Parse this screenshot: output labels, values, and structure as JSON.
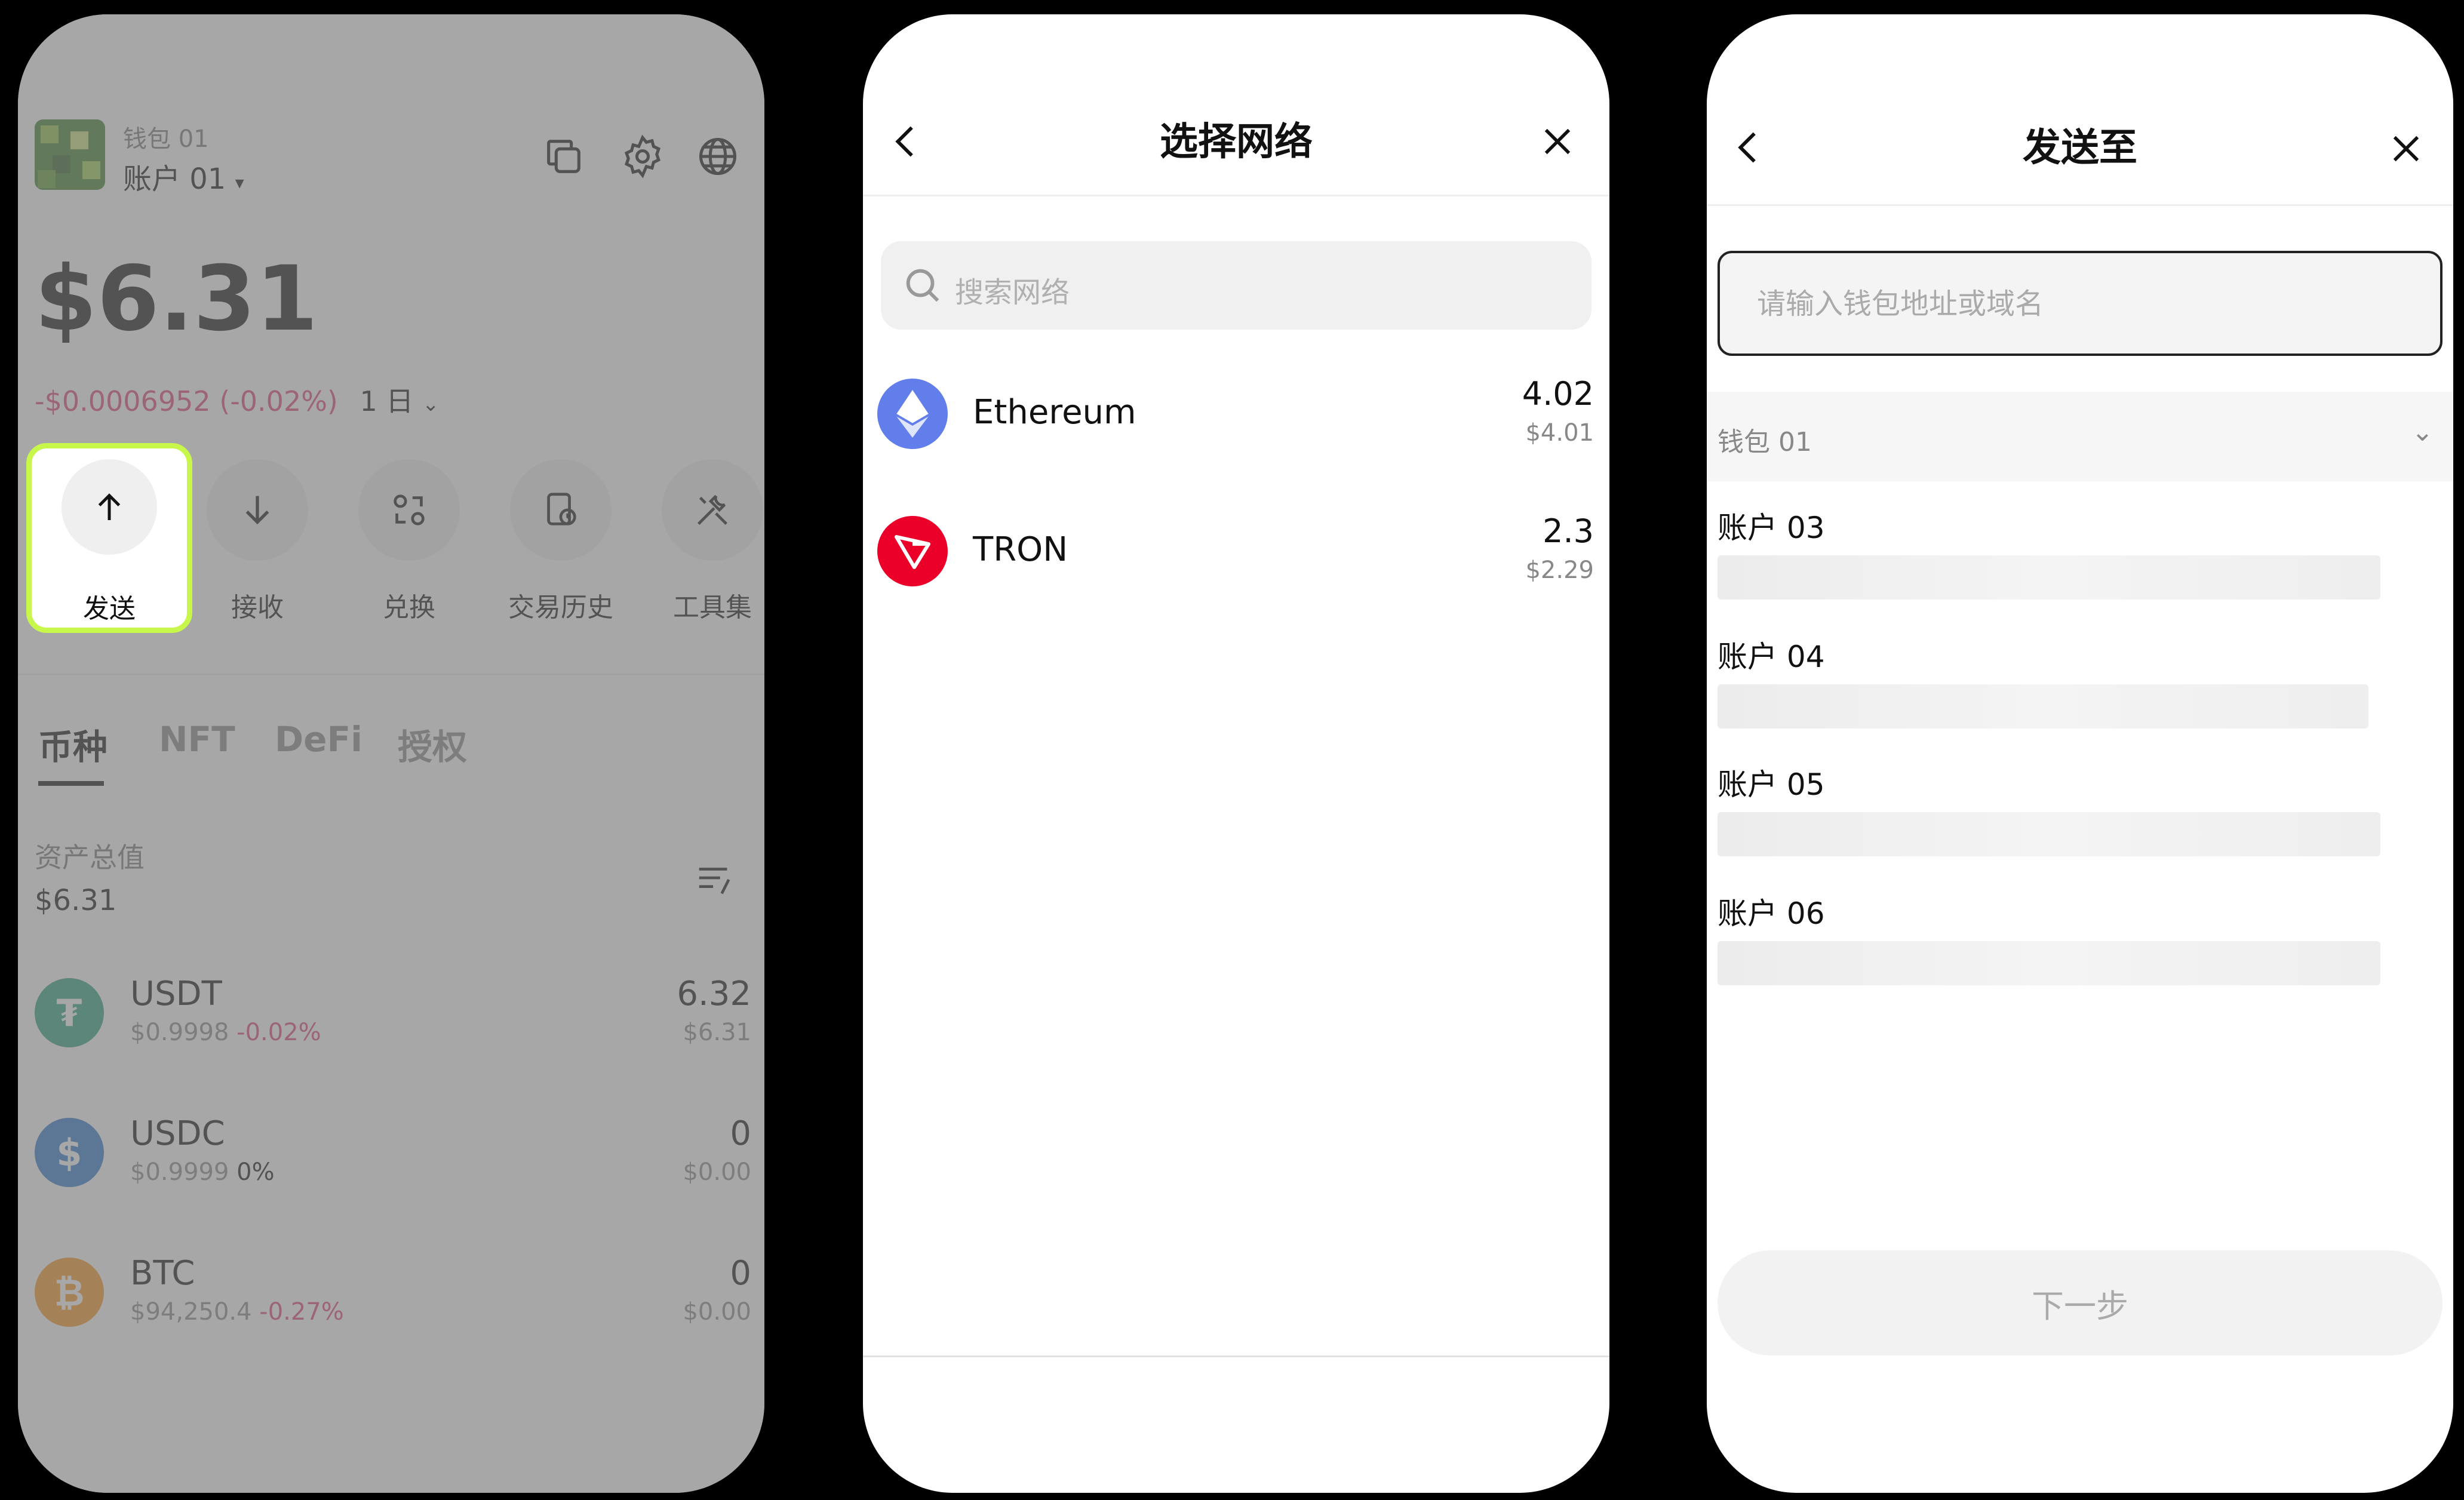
{
  "wallet_home": {
    "wallet_name": "钱包 01",
    "account_name": "账户 01",
    "balance": "$6.31",
    "change": "-$0.0006952 (-0.02%)",
    "period": "1 日",
    "actions": [
      {
        "label": "发送",
        "icon": "arrow-up-icon"
      },
      {
        "label": "接收",
        "icon": "arrow-down-icon"
      },
      {
        "label": "兑换",
        "icon": "swap-icon"
      },
      {
        "label": "交易历史",
        "icon": "history-icon"
      },
      {
        "label": "工具集",
        "icon": "tools-icon"
      }
    ],
    "tabs": [
      "币种",
      "NFT",
      "DeFi",
      "授权"
    ],
    "total_label": "资产总值",
    "total_value": "$6.31",
    "coins": [
      {
        "symbol": "USDT",
        "price": "$0.9998",
        "change": "-0.02%",
        "amount": "6.32",
        "usd": "$6.31",
        "color": "#26a17b"
      },
      {
        "symbol": "USDC",
        "price": "$0.9999",
        "change": "0%",
        "amount": "0",
        "usd": "$0.00",
        "color": "#2775ca"
      },
      {
        "symbol": "BTC",
        "price": "$94,250.4",
        "change": "-0.27%",
        "amount": "0",
        "usd": "$0.00",
        "color": "#f7931a"
      }
    ],
    "highlight_color": "#c7f74b"
  },
  "select_network": {
    "title": "选择网络",
    "search_placeholder": "搜索网络",
    "networks": [
      {
        "name": "Ethereum",
        "amount": "4.02",
        "usd": "$4.01",
        "color": "#627eea"
      },
      {
        "name": "TRON",
        "amount": "2.3",
        "usd": "$2.29",
        "color": "#eb0029"
      }
    ]
  },
  "send_to": {
    "title": "发送至",
    "address_placeholder": "请输入钱包地址或域名",
    "wallet_group": "钱包 01",
    "accounts": [
      "账户 03",
      "账户 04",
      "账户 05",
      "账户 06"
    ],
    "next_label": "下一步"
  }
}
